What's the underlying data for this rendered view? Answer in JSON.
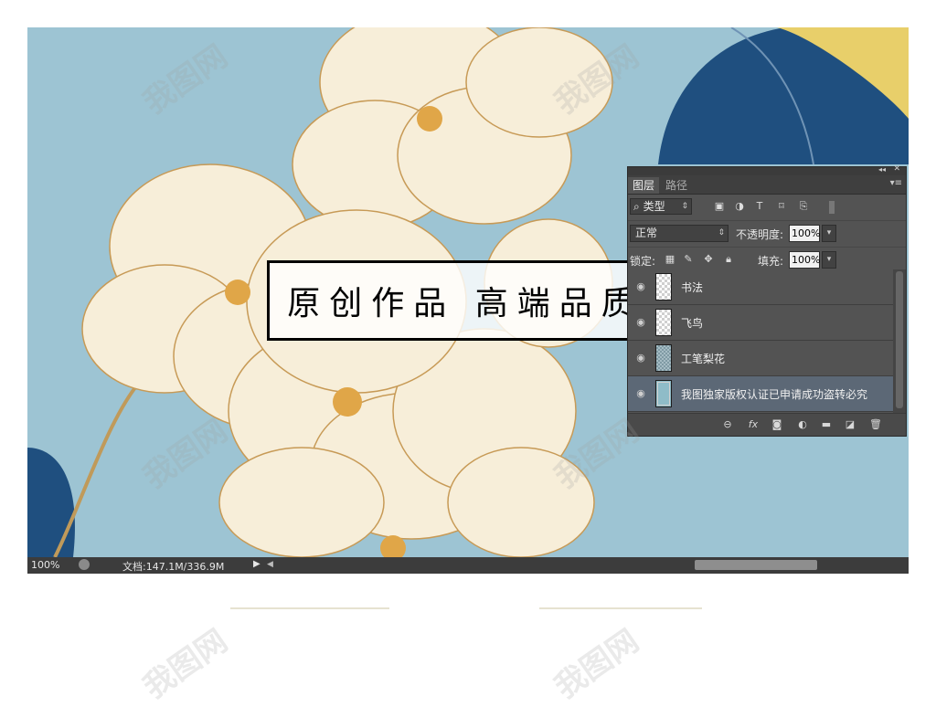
{
  "banner": {
    "text": "原创作品 高端品质"
  },
  "statusbar": {
    "zoom": "100%",
    "doc_info": "文档:147.1M/336.9M"
  },
  "panel": {
    "tabs": [
      "图层",
      "路径"
    ],
    "filter_label": "类型",
    "blend_mode": "正常",
    "opacity_label": "不透明度:",
    "opacity_value": "100%",
    "lock_label": "锁定:",
    "fill_label": "填充:",
    "fill_value": "100%",
    "layers": [
      {
        "name": "书法",
        "visible": true,
        "selected": false
      },
      {
        "name": "飞鸟",
        "visible": true,
        "selected": false
      },
      {
        "name": "工笔梨花",
        "visible": true,
        "selected": false
      },
      {
        "name": "我图独家版权认证已申请成功盗转必究",
        "visible": true,
        "selected": true
      }
    ],
    "bottom_icons": [
      "link-icon",
      "fx-icon",
      "mask-icon",
      "adjustment-icon",
      "folder-icon",
      "new-layer-icon",
      "trash-icon"
    ]
  },
  "watermark": {
    "text": "我图网"
  },
  "colors": {
    "background_blue": "#9dc4d3",
    "petal_cream": "#f7eed9",
    "leaf_blue": "#1f4f7f",
    "leaf_yellow": "#e8cf6a",
    "panel_bg": "#535353",
    "selected_layer": "#5c6876"
  }
}
